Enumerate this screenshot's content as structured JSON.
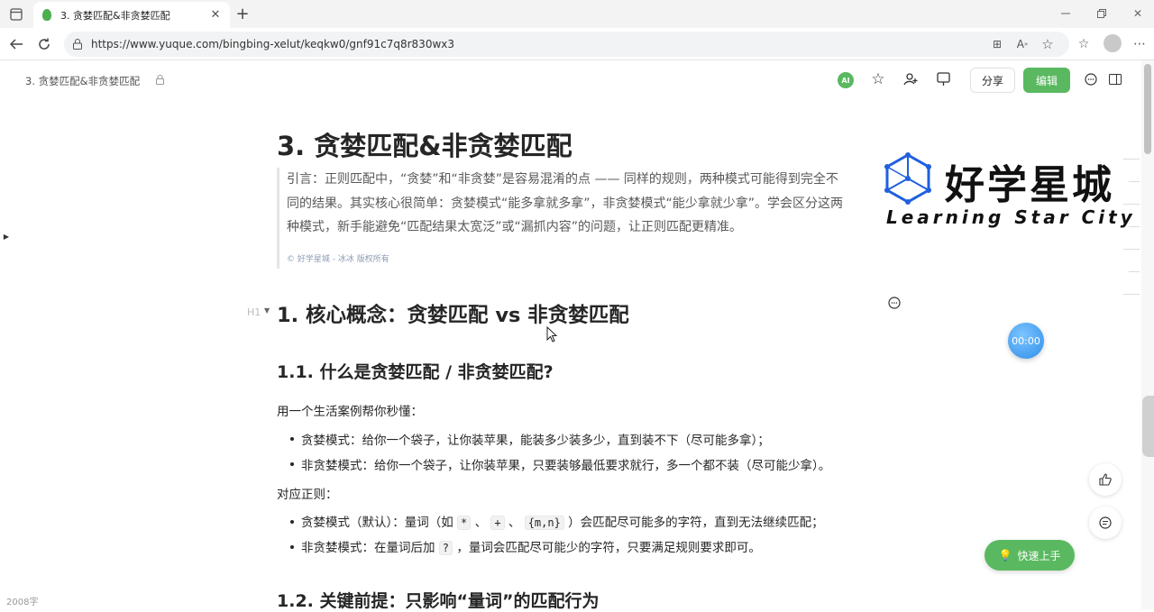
{
  "browser": {
    "tab_title": "3. 贪婪匹配&非贪婪匹配",
    "url": "https://www.yuque.com/bingbing-xelut/keqkw0/gnf91c7q8r830wx3"
  },
  "doc_header": {
    "breadcrumb_title": "3. 贪婪匹配&非贪婪匹配",
    "ai_label": "AI",
    "share_label": "分享",
    "edit_label": "编辑"
  },
  "watermark": {
    "cn": "好学星城",
    "en": "Learning Star City"
  },
  "article": {
    "title": "3. 贪婪匹配&非贪婪匹配",
    "quote_lines": [
      "引言：正则匹配中，“贪婪”和“非贪婪”是容易混淆的点 —— 同样的规则，两种模式可能得到完全不",
      "同的结果。其实核心很简单：贪婪模式“能多拿就多拿”，非贪婪模式“能少拿就少拿”。学会区分这两",
      "种模式，新手能避免“匹配结果太宽泛”或“漏抓内容”的问题，让正则匹配更精准。"
    ],
    "copyright": "好学星城 - 冰冰 版权所有",
    "h_marker": "H1",
    "h1": "1. 核心概念：贪婪匹配 vs 非贪婪匹配",
    "h2_1": "1.1. 什么是贪婪匹配 / 非贪婪匹配?",
    "intro": "用一个生活案例帮你秒懂：",
    "life_items": [
      "贪婪模式：给你一个袋子，让你装苹果，能装多少装多少，直到装不下（尽可能多拿）；",
      "非贪婪模式：给你一个袋子，让你装苹果，只要装够最低要求就行，多一个都不装（尽可能少拿）。"
    ],
    "regex_intro": "对应正则：",
    "greedy": {
      "prefix": "贪婪模式（默认）：量词（如 ",
      "code1": "*",
      "sep1": " 、 ",
      "code2": "+",
      "sep2": " 、 ",
      "code3": "{m,n}",
      "suffix": " ）会匹配尽可能多的字符，直到无法继续匹配；"
    },
    "nongreedy": {
      "prefix": "非贪婪模式：在量词后加 ",
      "code": "?",
      "suffix": " ，量词会匹配尽可能少的字符，只要满足规则要求即可。"
    },
    "h2_2": "1.2. 关键前提：只影响“量词”的匹配行为"
  },
  "floating": {
    "timer": "00:00",
    "quick_start": "快速上手",
    "word_count": "2008字"
  },
  "colors": {
    "accent_green": "#5ab960",
    "timer_blue": "#3a9ff5",
    "watermark_blue": "#1f5fe0"
  }
}
